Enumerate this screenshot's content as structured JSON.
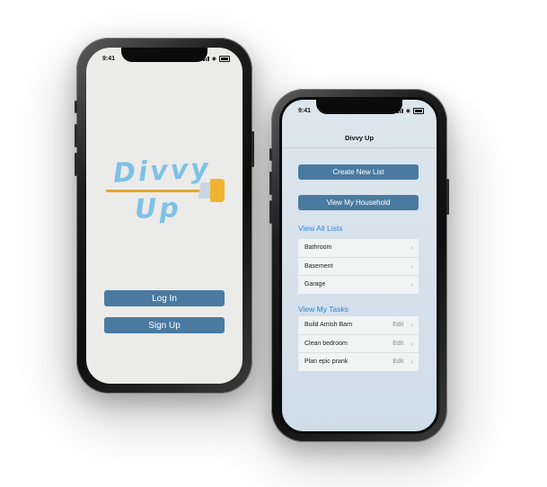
{
  "phone1": {
    "status_time": "9:41",
    "logo": {
      "line1": "Divvy",
      "line2": "Up",
      "text_color": "#7fc1e6",
      "broom_color": "#f0b431"
    },
    "buttons": {
      "login": "Log In",
      "signup": "Sign Up"
    },
    "button_color": "#4a7aa0"
  },
  "phone2": {
    "status_time": "9:41",
    "title": "Divvy Up",
    "buttons": {
      "create_list": "Create New List",
      "view_household": "View My Household"
    },
    "lists_section": {
      "label": "View All Lists",
      "items": [
        {
          "label": "Bathroom"
        },
        {
          "label": "Basement"
        },
        {
          "label": "Garage"
        }
      ]
    },
    "tasks_section": {
      "label": "View My Tasks",
      "items": [
        {
          "label": "Build Amish Barn",
          "action": "Edit"
        },
        {
          "label": "Clean bedroom",
          "action": "Edit"
        },
        {
          "label": "Plan epic prank",
          "action": "Edit"
        }
      ]
    },
    "link_color": "#2b86e6",
    "chevron_icon": "chevron-right-icon"
  }
}
